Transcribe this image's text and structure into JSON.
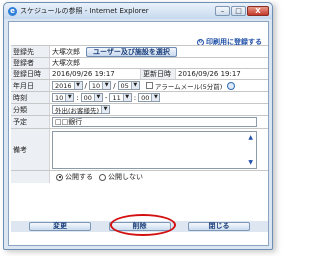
{
  "window": {
    "title": "スケジュールの参照 - Internet Explorer",
    "icon": "internet-explorer-icon",
    "controls": {
      "minimize": "–",
      "maximize": "□",
      "close": "X"
    }
  },
  "print_link": {
    "label": "印刷用に登録する"
  },
  "form": {
    "registrant": {
      "label": "登録先",
      "value": "大塚次郎",
      "button": "ユーザー及び施設を選択"
    },
    "creator": {
      "label": "登録者",
      "value": "大塚次郎"
    },
    "registered": {
      "label": "登録日時",
      "value": "2016/09/26 19:17",
      "updated_label": "更新日時",
      "updated_value": "2016/09/26 19:17"
    },
    "date": {
      "label": "年月日",
      "year": "2016",
      "month": "10",
      "day": "05",
      "sep": "/",
      "alarm": "アラームメール(5分前)"
    },
    "time": {
      "label": "時刻",
      "start_hour": "10",
      "start_min": "00",
      "dash": "-",
      "end_hour": "11",
      "end_min": "00"
    },
    "category": {
      "label": "分類",
      "value": "外出(お客様先)"
    },
    "subject": {
      "label": "予定",
      "value": "□□銀行"
    },
    "notes": {
      "label": "備考",
      "value": ""
    },
    "visibility": {
      "public": "公開する",
      "private": "公開しない",
      "selected": "public"
    }
  },
  "actions": {
    "change": "変更",
    "delete": "削除",
    "close": "閉じる"
  },
  "colors": {
    "accent": "#1f4fa8",
    "highlight": "#d31010"
  }
}
